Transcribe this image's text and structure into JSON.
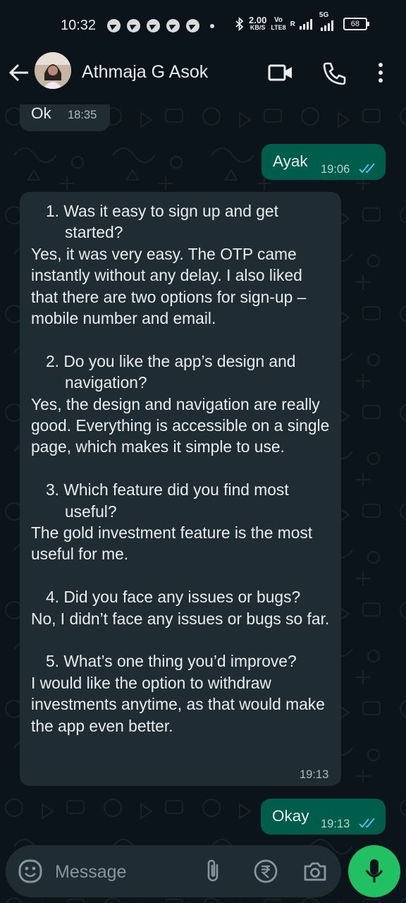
{
  "status_bar": {
    "time": "10:32",
    "net_speed_value": "2.00",
    "net_speed_unit": "KB/S",
    "volte_top": "Vo",
    "volte_bottom": "LTE8",
    "roaming": "R",
    "network_type": "5G",
    "battery": "68"
  },
  "header": {
    "contact_name": "Athmaja G Asok",
    "icons": [
      "back-arrow-icon",
      "video-call-icon",
      "voice-call-icon",
      "more-options-icon"
    ]
  },
  "messages": [
    {
      "direction": "incoming",
      "text": "Ok",
      "time": "18:35"
    },
    {
      "direction": "outgoing",
      "text": "Ayak",
      "time": "19:06",
      "status": "read"
    },
    {
      "direction": "incoming",
      "time": "19:13",
      "qa": [
        {
          "question": "1. Was it easy to sign up and get started?",
          "answer": "Yes, it was very easy. The OTP came instantly without any delay. I also liked that there are two options for sign-up – mobile number and email."
        },
        {
          "question": "2. Do you like the app’s design and navigation?",
          "answer": "Yes, the design and navigation are really good. Everything is accessible on a single page, which makes it simple to use."
        },
        {
          "question": "3. Which feature did you find most useful?",
          "answer": "The gold investment feature is the most useful for me."
        },
        {
          "question": "4. Did you face any issues or bugs?",
          "answer": "No, I didn’t face any issues or bugs so far."
        },
        {
          "question": "5. What’s one thing you’d improve?",
          "answer": "I would like the option to withdraw investments anytime, as that would make the app even better."
        }
      ]
    },
    {
      "direction": "outgoing",
      "text": "Okay",
      "time": "19:13",
      "status": "read"
    }
  ],
  "composer": {
    "placeholder": "Message",
    "icons": [
      "emoji-icon",
      "attach-icon",
      "rupee-payment-icon",
      "camera-icon",
      "mic-icon"
    ]
  },
  "colors": {
    "background": "#0b141a",
    "incoming_bubble": "#202c33",
    "outgoing_bubble": "#005c4b",
    "accent_green": "#21c063",
    "read_tick": "#53bdeb"
  }
}
